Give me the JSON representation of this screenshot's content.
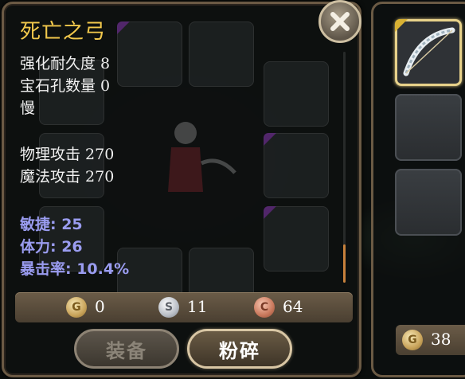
{
  "item": {
    "name": "死亡之弓",
    "durability": "强化耐久度 8",
    "gem_slots": "宝石孔数量 0",
    "speed": "慢",
    "phys_attack": "物理攻击 270",
    "magic_attack": "魔法攻击 270",
    "agility": "敏捷: 25",
    "stamina": "体力: 26",
    "crit": "暴击率: 10.4%"
  },
  "currency": {
    "gold": "0",
    "silver": "11",
    "copper": "64",
    "gold_symbol": "G",
    "silver_symbol": "S",
    "copper_symbol": "C"
  },
  "buttons": {
    "equip": "装备",
    "smash": "粉碎"
  },
  "side_panel": {
    "gold": "38"
  },
  "colors": {
    "title": "#f2c94c",
    "stat_blue": "#9a9cf0",
    "panel_border": "#6b5a44"
  },
  "icons": [
    "close-icon",
    "bow-icon",
    "gold-coin-icon",
    "silver-coin-icon",
    "copper-coin-icon"
  ]
}
